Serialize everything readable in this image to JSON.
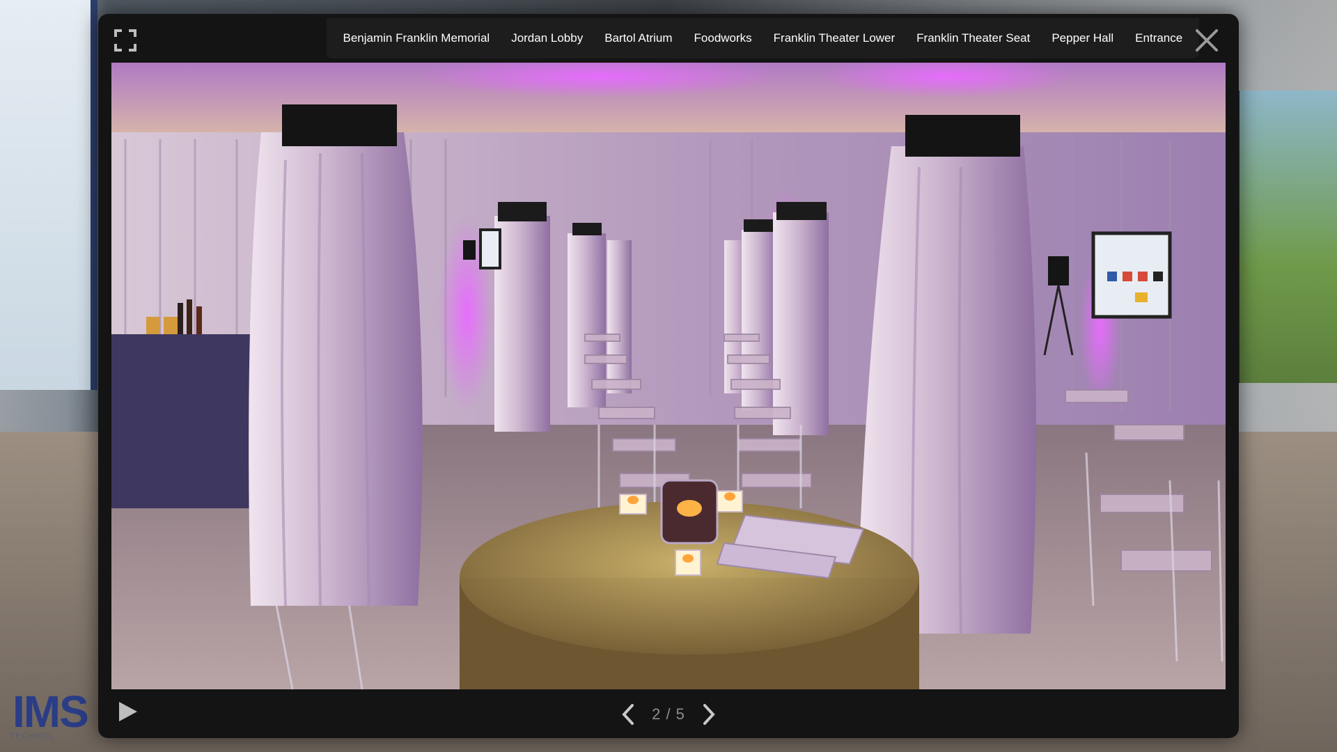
{
  "tour": {
    "logo_text": "IMS",
    "logo_subtext": "TECHNOL"
  },
  "nav": {
    "tabs": [
      {
        "label": "Benjamin Franklin Memorial"
      },
      {
        "label": "Jordan Lobby"
      },
      {
        "label": "Bartol Atrium"
      },
      {
        "label": "Foodworks"
      },
      {
        "label": "Franklin Theater Lower"
      },
      {
        "label": "Franklin Theater Seat"
      },
      {
        "label": "Pepper Hall"
      },
      {
        "label": "Entrance"
      }
    ]
  },
  "viewer": {
    "icons": {
      "fullscreen": "fullscreen-icon",
      "close": "close-icon",
      "play": "play-icon",
      "prev": "chevron-left-icon",
      "next": "chevron-right-icon"
    },
    "pager": {
      "current": 2,
      "total": 5,
      "text": "2 / 5"
    }
  },
  "colors": {
    "modal_bg": "#141414",
    "uplight": "#c45cff",
    "text": "#ffffff",
    "pager_text": "#8e8e8e"
  }
}
